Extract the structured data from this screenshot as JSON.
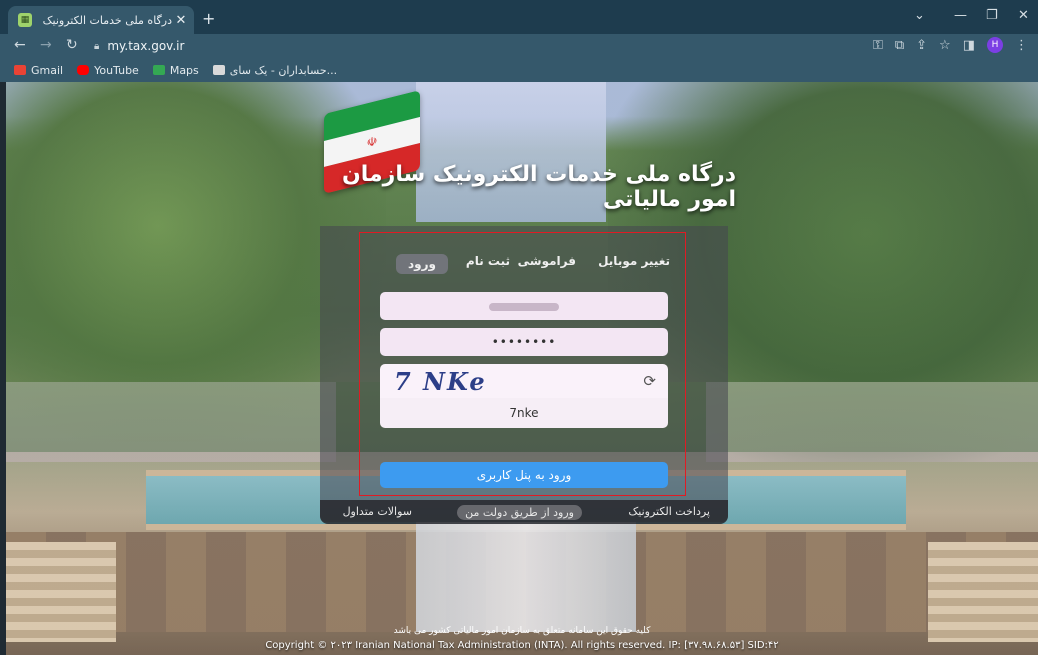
{
  "browser": {
    "tab_title": "درگاه ملی خدمات الکترونیک سازما",
    "tab_close": "✕",
    "new_tab": "+",
    "url": "my.tax.gov.ir",
    "profile_initial": "H",
    "bookmarks": [
      {
        "label": "Gmail",
        "color": "#ea4335"
      },
      {
        "label": "YouTube",
        "color": "#ff0000"
      },
      {
        "label": "Maps",
        "color": "#34a853"
      },
      {
        "label": "حسابداران - یک سای...",
        "color": "#d9d9d9"
      }
    ]
  },
  "site": {
    "title": "درگاه ملی خدمات الکترونیک سازمان امور مالیاتی",
    "flag_emblem": "☫"
  },
  "login": {
    "tabs": {
      "login": "ورود",
      "register": "ثبت نام",
      "forgot": "فراموشی",
      "change_mobile": "تغییر موبایل"
    },
    "password_mask": "••••••••",
    "captcha_image_text": "7 NKe",
    "captcha_input": "7nke",
    "submit": "ورود به پنل کاربری"
  },
  "links": {
    "faq": "سوالات متداول",
    "gov_login": "ورود از طریق دولت من",
    "e_payment": "پرداخت الکترونیک"
  },
  "footer": {
    "rights_fa": "کلیه حقوق این سامانه متعلق به سازمان امور مالیاتی کشور می باشد",
    "copyright_en": "Copyright © ۲۰۲۳ Iranian National Tax Administration (INTA). All rights reserved. IP: [۳۷.۹۸.۶۸.۵۳] SID:۴۲"
  }
}
